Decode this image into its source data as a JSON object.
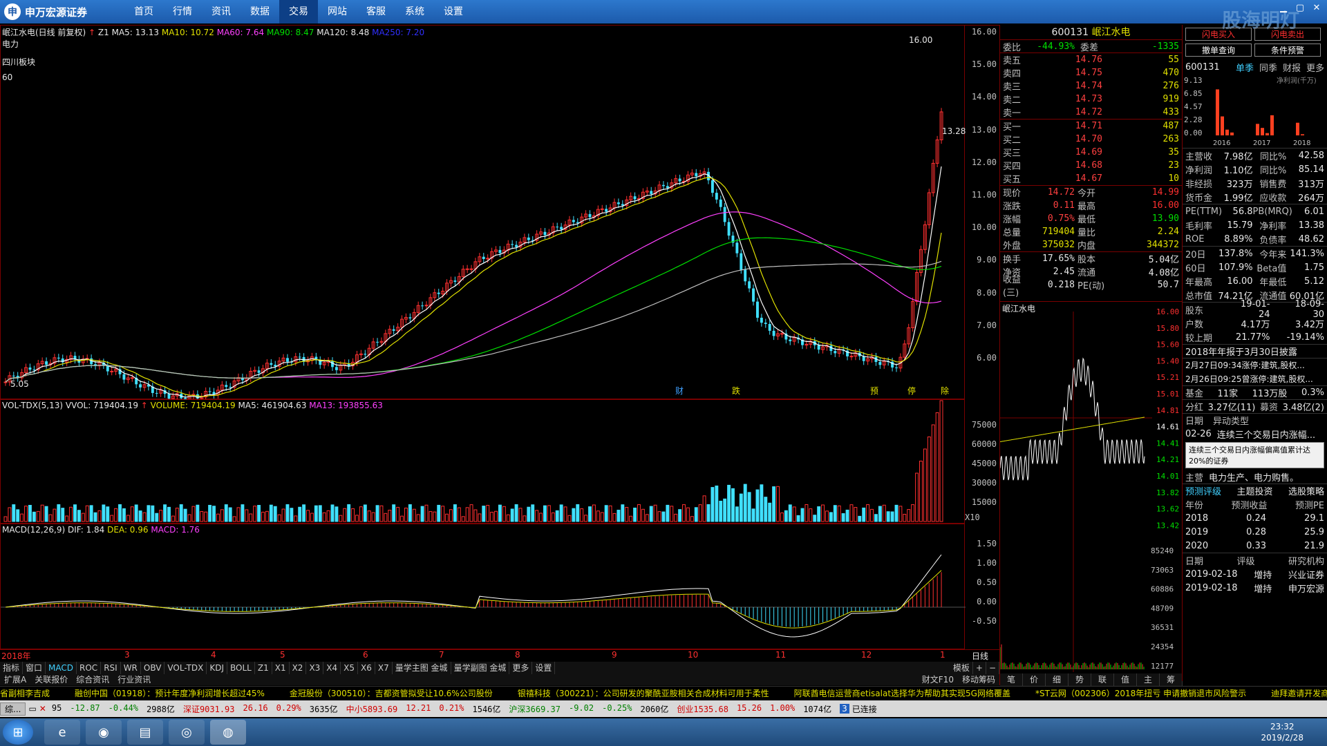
{
  "app": {
    "logo_text": "申万宏源证券",
    "menu": [
      "首页",
      "行情",
      "资讯",
      "数据",
      "交易",
      "网站",
      "客服",
      "系统",
      "设置"
    ],
    "active_menu": "交易",
    "watermark": "股海明灯"
  },
  "kline": {
    "header": "岷江水电(日线 前复权)",
    "z1": "Z1",
    "ma5": "MA5: 13.13",
    "ma10": "MA10: 10.72",
    "ma60": "MA60: 7.64",
    "ma90": "MA90: 8.47",
    "ma120": "MA120: 8.48",
    "ma250": "MA250: 7.20",
    "side_labels": [
      "电力",
      "四川板块",
      "60"
    ],
    "high_label": "16.00",
    "low_label": "5.05",
    "mid_label": "13.28",
    "yaxis": [
      "16.00",
      "15.00",
      "14.00",
      "13.00",
      "12.00",
      "11.00",
      "10.00",
      "9.00",
      "8.00",
      "7.00",
      "6.00"
    ],
    "events": [
      "财",
      "跌",
      "预",
      "停",
      "除"
    ]
  },
  "volume": {
    "header": "VOL-TDX(5,13)",
    "vvol": "VVOL: 719404.19",
    "volume": "VOLUME: 719404.19",
    "ma5": "MA5: 461904.63",
    "ma13": "MA13: 193855.63",
    "yaxis": [
      "75000",
      "60000",
      "45000",
      "30000",
      "15000"
    ],
    "unit": "X10"
  },
  "macd": {
    "header": "MACD(12,26,9)",
    "dif": "DIF: 1.84",
    "dea": "DEA: 0.96",
    "macd": "MACD: 1.76",
    "yaxis": [
      "1.50",
      "1.00",
      "0.50",
      "0.00",
      "-0.50"
    ]
  },
  "xaxis": {
    "labels": [
      "2018年",
      "3",
      "4",
      "5",
      "6",
      "7",
      "8",
      "9",
      "10",
      "11",
      "12",
      "1",
      "2"
    ],
    "right_label": "日线"
  },
  "tabs": [
    "指标",
    "窗口",
    "MACD",
    "ROC",
    "RSI",
    "WR",
    "OBV",
    "VOL-TDX",
    "KDJ",
    "BOLL",
    "Z1",
    "X1",
    "X2",
    "X3",
    "X4",
    "X5",
    "X6",
    "X7",
    "量学主图 金城",
    "量学副图 金城",
    "更多",
    "设置"
  ],
  "tabs_right": [
    "模板",
    "+",
    "−"
  ],
  "tabs2": [
    "扩展A",
    "关联报价",
    "综合资讯",
    "行业资讯"
  ],
  "tabs2_right": [
    "财文F10",
    "移动筹码"
  ],
  "quote": {
    "code": "600131",
    "name": "岷江水电",
    "wb_label": "委比",
    "wb_value": "-44.93%",
    "wc_label": "委差",
    "wc_value": "-1335",
    "sells": [
      {
        "label": "卖五",
        "price": "14.76",
        "vol": "55"
      },
      {
        "label": "卖四",
        "price": "14.75",
        "vol": "470"
      },
      {
        "label": "卖三",
        "price": "14.74",
        "vol": "276"
      },
      {
        "label": "卖二",
        "price": "14.73",
        "vol": "919"
      },
      {
        "label": "卖一",
        "price": "14.72",
        "vol": "433"
      }
    ],
    "buys": [
      {
        "label": "买一",
        "price": "14.71",
        "vol": "487"
      },
      {
        "label": "买二",
        "price": "14.70",
        "vol": "263"
      },
      {
        "label": "买三",
        "price": "14.69",
        "vol": "35"
      },
      {
        "label": "买四",
        "price": "14.68",
        "vol": "23"
      },
      {
        "label": "买五",
        "price": "14.67",
        "vol": "10"
      }
    ],
    "stats": [
      {
        "l1": "现价",
        "v1": "14.72",
        "l2": "今开",
        "v2": "14.99"
      },
      {
        "l1": "涨跌",
        "v1": "0.11",
        "l2": "最高",
        "v2": "16.00"
      },
      {
        "l1": "涨幅",
        "v1": "0.75%",
        "l2": "最低",
        "v2": "13.90"
      },
      {
        "l1": "总量",
        "v1": "719404",
        "l2": "量比",
        "v2": "2.24"
      },
      {
        "l1": "外盘",
        "v1": "375032",
        "l2": "内盘",
        "v2": "344372"
      }
    ],
    "stats2": [
      {
        "l1": "换手",
        "v1": "17.65%",
        "l2": "股本",
        "v2": "5.04亿"
      },
      {
        "l1": "净资",
        "v1": "2.45",
        "l2": "流通",
        "v2": "4.08亿"
      },
      {
        "l1": "收益(三)",
        "v1": "0.218",
        "l2": "PE(动)",
        "v2": "50.7"
      }
    ],
    "mini_title": "岷江水电",
    "mini_yaxis": [
      "16.00",
      "15.80",
      "15.60",
      "15.40",
      "15.21",
      "15.01",
      "14.81",
      "14.61",
      "14.41",
      "14.21",
      "14.01",
      "13.82",
      "13.62",
      "13.42"
    ],
    "mini_vaxis": [
      "85240",
      "73063",
      "60886",
      "48709",
      "36531",
      "24354",
      "12177"
    ],
    "bottom_tabs": [
      "笔",
      "价",
      "细",
      "势",
      "联",
      "值",
      "主",
      "筹"
    ]
  },
  "f10": {
    "buttons": [
      "闪电买入",
      "闪电卖出",
      "撤单查询",
      "条件预警"
    ],
    "code": "600131",
    "tabs": [
      "单季",
      "同季",
      "财报",
      "更多"
    ],
    "bar_yaxis": [
      "9.13",
      "6.85",
      "4.57",
      "2.28",
      "0.00"
    ],
    "bar_unit": "净利润(千万)",
    "bar_years": [
      "2016",
      "2017",
      "2018"
    ],
    "bar_values": [
      8.0,
      3.3,
      1.0,
      0.5,
      2.0,
      1.3,
      0.4,
      3.5,
      2.2,
      0.2
    ],
    "rows1": [
      {
        "l": "主营收",
        "v": "7.98亿",
        "l2": "同比%",
        "v2": "42.58"
      },
      {
        "l": "净利润",
        "v": "1.10亿",
        "l2": "同比%",
        "v2": "85.14"
      },
      {
        "l": "非经损",
        "v": "323万",
        "l2": "销售费",
        "v2": "313万"
      },
      {
        "l": "货币金",
        "v": "1.99亿",
        "l2": "应收款",
        "v2": "264万"
      }
    ],
    "rows2": [
      {
        "l": "PE(TTM)",
        "v": "56.8",
        "l2": "PB(MRQ)",
        "v2": "6.01"
      },
      {
        "l": "毛利率",
        "v": "15.79",
        "l2": "净利率",
        "v2": "13.38"
      },
      {
        "l": "ROE",
        "v": "8.89%",
        "l2": "负债率",
        "v2": "48.62"
      }
    ],
    "rows3": [
      {
        "l": "20日",
        "v": "137.8%",
        "l2": "今年来",
        "v2": "141.3%"
      },
      {
        "l": "60日",
        "v": "107.9%",
        "l2": "Beta值",
        "v2": "1.75"
      },
      {
        "l": "年最高",
        "v": "16.00",
        "l2": "年最低",
        "v2": "5.12"
      },
      {
        "l": "总市值",
        "v": "74.21亿",
        "l2": "流通值",
        "v2": "60.01亿"
      }
    ],
    "rows4": [
      {
        "l": "股东",
        "v": "19-01-24",
        "v2": "18-09-30"
      },
      {
        "l": "户数",
        "v": "4.17万",
        "v2": "3.42万"
      },
      {
        "l": "较上期",
        "v": "21.77%",
        "v2": "-19.14%"
      }
    ],
    "notice": "2018年年报于3月30日披露",
    "news": [
      "2月27日09:34涨停:建筑,股权...",
      "2月26日09:25曾涨停:建筑,股权..."
    ],
    "fund": {
      "l": "基金",
      "v1": "11家",
      "v2": "113万股",
      "v3": "0.3%"
    },
    "div": {
      "l": "分红",
      "v1": "3.27亿(11)",
      "l2": "募资",
      "v2": "3.48亿(2)"
    },
    "abn_header": {
      "l": "日期",
      "v": "异动类型"
    },
    "abn_row": {
      "l": "02-26",
      "v": "连续三个交易日内涨幅..."
    },
    "tooltip": "连续三个交易日内涨幅偏离值累计达20%的证券",
    "main_biz": {
      "l": "主营",
      "v": "电力生产、电力购售。"
    },
    "pred_tabs": [
      "预测评级",
      "主题投资",
      "选股策略"
    ],
    "pred_header": [
      "年份",
      "预测收益",
      "预测PE"
    ],
    "pred": [
      {
        "y": "2018",
        "e": "0.24",
        "pe": "29.1"
      },
      {
        "y": "2019",
        "e": "0.28",
        "pe": "25.9"
      },
      {
        "y": "2020",
        "e": "0.33",
        "pe": "21.9"
      }
    ],
    "rate_header": [
      "日期",
      "评级",
      "研究机构"
    ],
    "rates": [
      {
        "d": "2019-02-18",
        "r": "增持",
        "o": "兴业证券"
      },
      {
        "d": "2019-02-18",
        "r": "增持",
        "o": "申万宏源"
      }
    ]
  },
  "ticker": [
    "省副相李吉成",
    "融创中国（01918）：预计年度净利润增长超过45%",
    "金冠股份（300510）：吉都资管拟受让10.6%公司股份",
    "银禧科技（300221）：公司研发的聚酰亚胺相关合成材料可用于柔性",
    "阿联酋电信运营商etisalat选择华为帮助其实现5G网络覆盖",
    "*ST云网（002306）2018年扭亏  申请撤销退市风险警示",
    "迪拜邀请开发商"
  ],
  "status": {
    "left": "综...",
    "segs": [
      {
        "t": "95",
        "c": "white"
      },
      {
        "t": "-12.87",
        "c": "green"
      },
      {
        "t": "-0.44%",
        "c": "green"
      },
      {
        "t": "2988亿",
        "c": "white"
      },
      {
        "t": "深证9031.93",
        "c": "red"
      },
      {
        "t": "26.16",
        "c": "red"
      },
      {
        "t": "0.29%",
        "c": "red"
      },
      {
        "t": "3635亿",
        "c": "white"
      },
      {
        "t": "中小5893.69",
        "c": "red"
      },
      {
        "t": "12.21",
        "c": "red"
      },
      {
        "t": "0.21%",
        "c": "red"
      },
      {
        "t": "1546亿",
        "c": "white"
      },
      {
        "t": "沪深3669.37",
        "c": "green"
      },
      {
        "t": "-9.02",
        "c": "green"
      },
      {
        "t": "-0.25%",
        "c": "green"
      },
      {
        "t": "2060亿",
        "c": "white"
      },
      {
        "t": "创业1535.68",
        "c": "red"
      },
      {
        "t": "15.26",
        "c": "red"
      },
      {
        "t": "1.00%",
        "c": "red"
      },
      {
        "t": "1074亿",
        "c": "white"
      }
    ],
    "conn": "已连接"
  },
  "taskbar": {
    "time": "23:32",
    "date": "2019/2/28"
  },
  "colors": {
    "up": "#ff3030",
    "down": "#40e0ff",
    "ma5": "#ffffff",
    "ma10": "#e0e000",
    "ma60": "#ff40ff",
    "ma90": "#00e000",
    "ma120": "#c0c0c0",
    "ma250": "#2020ff"
  }
}
